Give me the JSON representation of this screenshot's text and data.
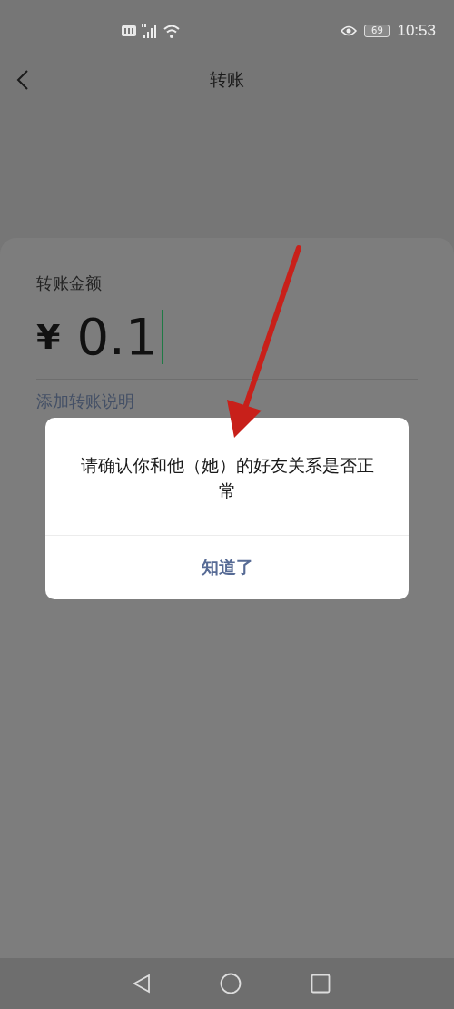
{
  "status_bar": {
    "battery": "69",
    "time": "10:53"
  },
  "header": {
    "title": "转账"
  },
  "transfer": {
    "label": "转账金额",
    "currency": "¥",
    "amount": "0.1",
    "note_link": "添加转账说明"
  },
  "dialog": {
    "message": "请确认你和他（她）的好友关系是否正常",
    "button": "知道了"
  }
}
